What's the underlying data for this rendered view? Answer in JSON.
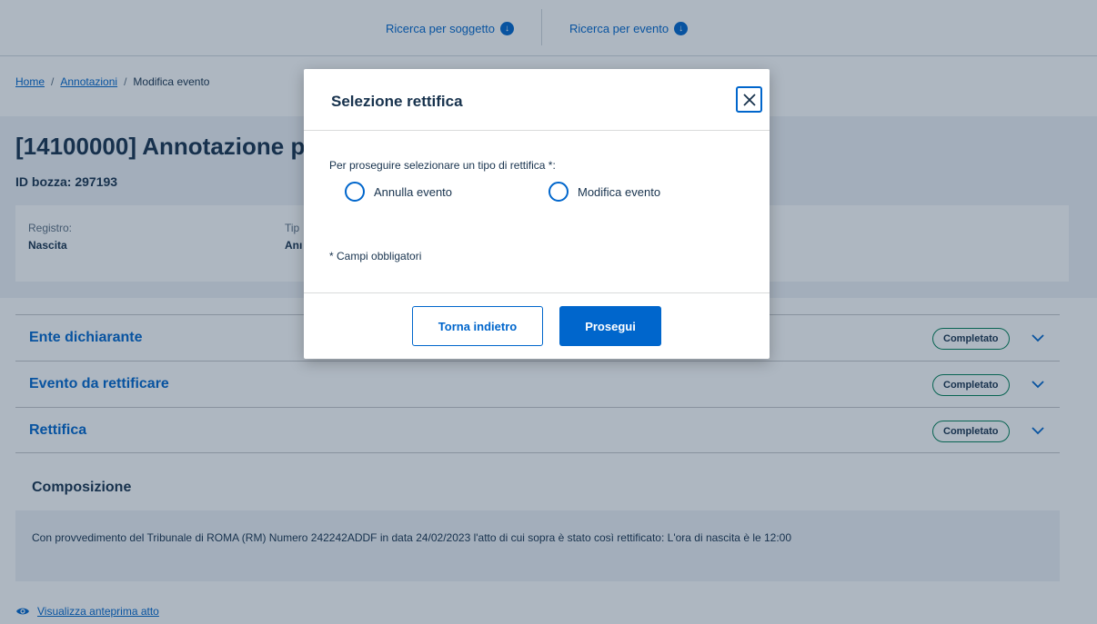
{
  "topnav": {
    "items": [
      {
        "label": "Ricerca per soggetto",
        "icon": "download-circle-icon"
      },
      {
        "label": "Ricerca per evento",
        "icon": "download-circle-icon"
      }
    ]
  },
  "breadcrumb": {
    "home": "Home",
    "annotazioni": "Annotazioni",
    "current": "Modifica evento",
    "separator": "/"
  },
  "page": {
    "title": "[14100000] Annotazione p",
    "draft_id": "ID bozza: 297193"
  },
  "info": {
    "registro_label": "Registro:",
    "registro_value": "Nascita",
    "tipo_label": "Tip",
    "tipo_value": "Anı"
  },
  "accordion": [
    {
      "title": "Ente dichiarante",
      "status": "Completato"
    },
    {
      "title": "Evento da rettificare",
      "status": "Completato"
    },
    {
      "title": "Rettifica",
      "status": "Completato"
    }
  ],
  "composition": {
    "title": "Composizione",
    "text": "Con provvedimento del Tribunale di ROMA (RM) Numero 242242ADDF in data 24/02/2023 l'atto di cui sopra è stato così rettificato: L'ora di nascita è le 12:00"
  },
  "preview_link": {
    "label": "Visualizza anteprima atto",
    "icon": "eye-icon"
  },
  "modal": {
    "title": "Selezione rettifica",
    "instruction": "Per proseguire selezionare un tipo di rettifica *:",
    "options": [
      {
        "label": "Annulla evento",
        "selected": false
      },
      {
        "label": "Modifica evento",
        "selected": false
      }
    ],
    "required_note": "* Campi obbligatori",
    "back_label": "Torna indietro",
    "continue_label": "Prosegui"
  },
  "colors": {
    "primary": "#0066cc",
    "text": "#17324d",
    "success": "#008055"
  }
}
